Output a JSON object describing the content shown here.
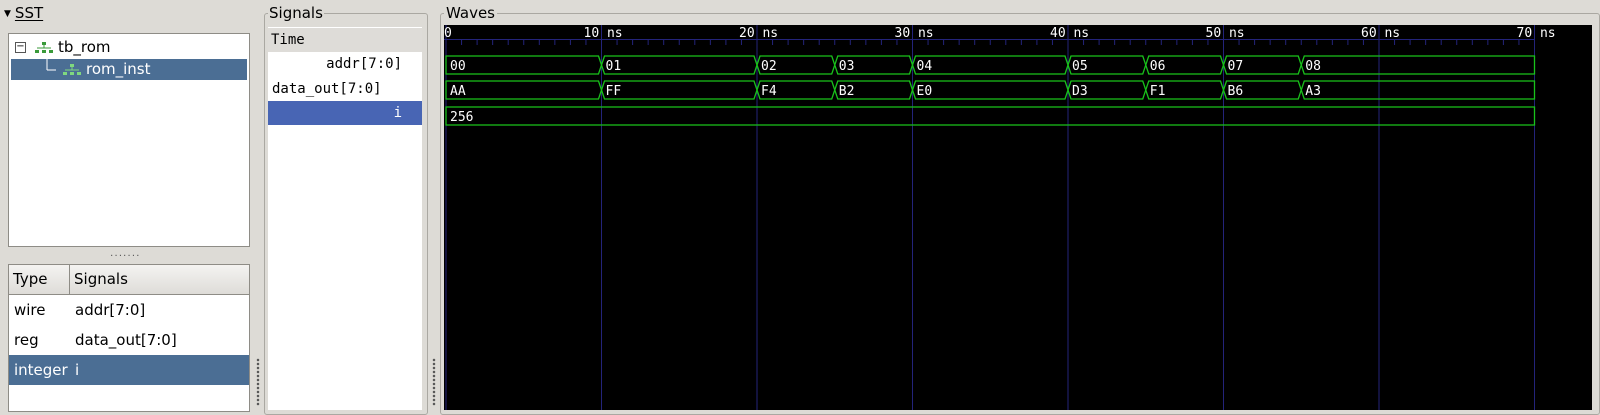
{
  "sst": {
    "title": "SST",
    "tree": [
      {
        "label": "tb_rom"
      },
      {
        "label": "rom_inst"
      }
    ],
    "grip": "․․․․․․․"
  },
  "signal_table": {
    "headers": {
      "type": "Type",
      "signals": "Signals"
    },
    "rows": [
      {
        "type": "wire",
        "signal": "addr[7:0]"
      },
      {
        "type": "reg",
        "signal": "data_out[7:0]"
      },
      {
        "type": "integer",
        "signal": "i"
      }
    ]
  },
  "signals_pane": {
    "title": "Signals",
    "rows": [
      "Time",
      "addr[7:0]",
      "data_out[7:0]",
      "i"
    ]
  },
  "waves_pane": {
    "title": "Waves",
    "time_unit": "ns",
    "time_max": 70,
    "major_tick": 10,
    "minor_tick": 1,
    "time_labels": [
      {
        "t": 0,
        "label": "0"
      },
      {
        "t": 10,
        "label": "10 ns"
      },
      {
        "t": 20,
        "label": "20 ns"
      },
      {
        "t": 30,
        "label": "30 ns"
      },
      {
        "t": 40,
        "label": "40 ns"
      },
      {
        "t": 50,
        "label": "50 ns"
      },
      {
        "t": 60,
        "label": "60 ns"
      },
      {
        "t": 70,
        "label": "70 ns"
      }
    ],
    "traces": [
      {
        "name": "addr[7:0]",
        "segments": [
          {
            "start": 0,
            "end": 10,
            "value": "00"
          },
          {
            "start": 10,
            "end": 20,
            "value": "01"
          },
          {
            "start": 20,
            "end": 25,
            "value": "02"
          },
          {
            "start": 25,
            "end": 30,
            "value": "03"
          },
          {
            "start": 30,
            "end": 40,
            "value": "04"
          },
          {
            "start": 40,
            "end": 45,
            "value": "05"
          },
          {
            "start": 45,
            "end": 50,
            "value": "06"
          },
          {
            "start": 50,
            "end": 55,
            "value": "07"
          },
          {
            "start": 55,
            "end": 70,
            "value": "08"
          }
        ]
      },
      {
        "name": "data_out[7:0]",
        "segments": [
          {
            "start": 0,
            "end": 10,
            "value": "AA"
          },
          {
            "start": 10,
            "end": 20,
            "value": "FF"
          },
          {
            "start": 20,
            "end": 25,
            "value": "F4"
          },
          {
            "start": 25,
            "end": 30,
            "value": "B2"
          },
          {
            "start": 30,
            "end": 40,
            "value": "E0"
          },
          {
            "start": 40,
            "end": 45,
            "value": "D3"
          },
          {
            "start": 45,
            "end": 50,
            "value": "F1"
          },
          {
            "start": 50,
            "end": 55,
            "value": "B6"
          },
          {
            "start": 55,
            "end": 70,
            "value": "A3"
          }
        ]
      },
      {
        "name": "i",
        "segments": [
          {
            "start": 0,
            "end": 70,
            "value": "256"
          }
        ]
      }
    ]
  },
  "colors": {
    "wave_bg": "#000000",
    "wave_line": "#19c21b",
    "grid": "#23237a",
    "selection": "#4b6e94",
    "signal_selection": "#4865b4"
  }
}
